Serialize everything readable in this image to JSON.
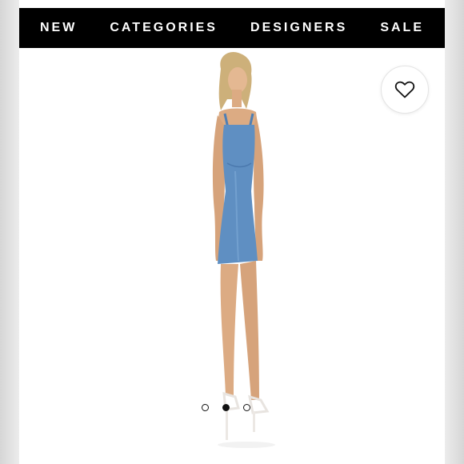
{
  "nav": {
    "items": [
      "NEW",
      "CATEGORIES",
      "DESIGNERS",
      "SALE"
    ]
  },
  "product": {
    "wishlist_icon": "heart-icon",
    "image_alt": "Model wearing blue satin mini dress",
    "dress_color": "#5f8fc2",
    "carousel": {
      "count": 3,
      "active_index": 1
    }
  },
  "colors": {
    "nav_bg": "#000000",
    "nav_text": "#ffffff",
    "page_bg": "#ffffff"
  }
}
